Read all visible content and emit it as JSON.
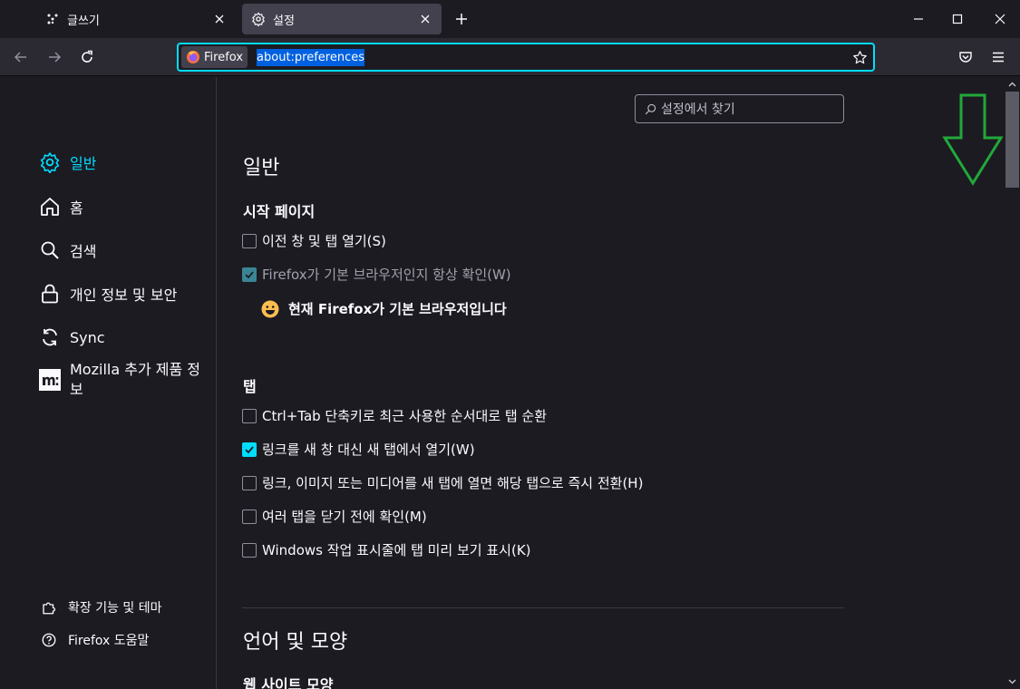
{
  "tabs": [
    {
      "label": "글쓰기",
      "icon": "dots-icon"
    },
    {
      "label": "설정",
      "icon": "gear-icon",
      "active": true
    }
  ],
  "urlbar": {
    "identity_label": "Firefox",
    "url": "about:preferences"
  },
  "sidebar": {
    "categories": [
      {
        "label": "일반",
        "icon": "gear-icon",
        "active": true
      },
      {
        "label": "홈",
        "icon": "home-icon"
      },
      {
        "label": "검색",
        "icon": "search-icon"
      },
      {
        "label": "개인 정보 및 보안",
        "icon": "lock-icon"
      },
      {
        "label": "Sync",
        "icon": "sync-icon"
      },
      {
        "label": "Mozilla 추가 제품 정보",
        "icon": "mozilla-icon"
      }
    ],
    "footer": [
      {
        "label": "확장 기능 및 테마",
        "icon": "puzzle-icon"
      },
      {
        "label": "Firefox 도움말",
        "icon": "help-icon"
      }
    ]
  },
  "search": {
    "placeholder": "설정에서 찾기"
  },
  "general": {
    "title": "일반",
    "startup": {
      "heading": "시작 페이지",
      "restore_session": "이전 창 및 탭 열기(S)",
      "check_default": "Firefox가 기본 브라우저인지 항상 확인(W)",
      "default_message": "현재 Firefox가 기본 브라우저입니다"
    },
    "tabs": {
      "heading": "탭",
      "options": [
        {
          "label": "Ctrl+Tab 단축키로 최근 사용한 순서대로 탭 순환",
          "checked": false
        },
        {
          "label": "링크를 새 창 대신 새 탭에서 열기(W)",
          "checked": true
        },
        {
          "label": "링크, 이미지 또는 미디어를 새 탭에 열면 해당 탭으로 즉시 전환(H)",
          "checked": false
        },
        {
          "label": "여러 탭을 닫기 전에 확인(M)",
          "checked": false
        },
        {
          "label": "Windows 작업 표시줄에 탭 미리 보기 표시(K)",
          "checked": false
        }
      ]
    }
  },
  "language": {
    "title": "언어 및 모양",
    "website_appearance": "웹 사이트 모양"
  },
  "colors": {
    "accent": "#00ddff",
    "background": "#1c1b22",
    "toolbar": "#2b2a33",
    "annotation_arrow": "#22a83a"
  }
}
